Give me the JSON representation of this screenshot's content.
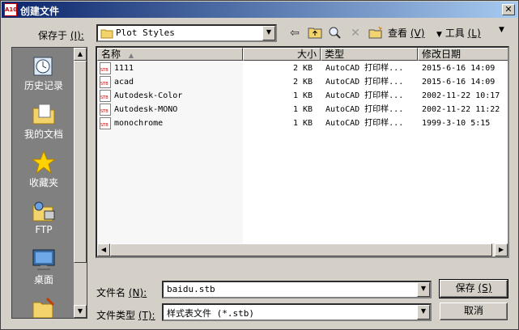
{
  "window": {
    "title": "创建文件",
    "close_glyph": "✕",
    "app_icon_text": "A10"
  },
  "toolbar": {
    "save_in_label": "保存于",
    "save_in_key": "(I):",
    "folder": "Plot Styles",
    "view_label": "查看",
    "view_key": "(V)",
    "tools_label": "工具",
    "tools_key": "(L)"
  },
  "places": [
    {
      "label": "历史记录",
      "icon": "history-icon"
    },
    {
      "label": "我的文档",
      "icon": "my-documents-icon"
    },
    {
      "label": "收藏夹",
      "icon": "favorites-icon"
    },
    {
      "label": "FTP",
      "icon": "ftp-icon"
    },
    {
      "label": "桌面",
      "icon": "desktop-icon"
    }
  ],
  "columns": {
    "name": "名称",
    "sort_glyph": "▲",
    "size": "大小",
    "type": "类型",
    "modified": "修改日期"
  },
  "files": [
    {
      "name": "1111",
      "size": "2 KB",
      "type": "AutoCAD 打印样...",
      "modified": "2015-6-16 14:09"
    },
    {
      "name": "acad",
      "size": "2 KB",
      "type": "AutoCAD 打印样...",
      "modified": "2015-6-16 14:09"
    },
    {
      "name": "Autodesk-Color",
      "size": "1 KB",
      "type": "AutoCAD 打印样...",
      "modified": "2002-11-22 10:17"
    },
    {
      "name": "Autodesk-MONO",
      "size": "1 KB",
      "type": "AutoCAD 打印样...",
      "modified": "2002-11-22 11:22"
    },
    {
      "name": "monochrome",
      "size": "1 KB",
      "type": "AutoCAD 打印样...",
      "modified": "1999-3-10 5:15"
    }
  ],
  "form": {
    "filename_label": "文件名",
    "filename_key": "(N):",
    "filename_value": "baidu.stb",
    "filetype_label": "文件类型",
    "filetype_key": "(T):",
    "filetype_value": "样式表文件 (*.stb)",
    "save_button": "保存",
    "save_key": "(S)",
    "cancel_button": "取消"
  }
}
